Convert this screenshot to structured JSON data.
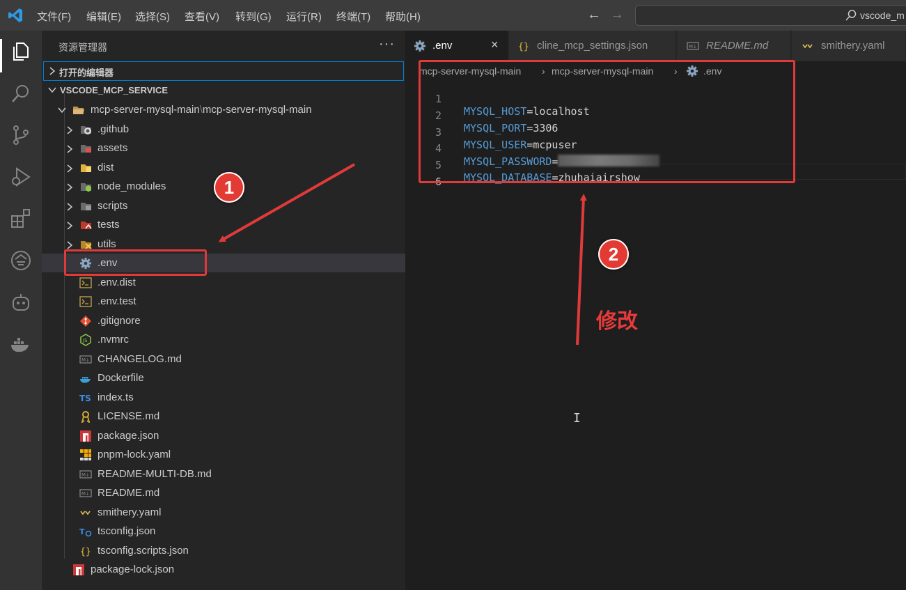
{
  "menu": [
    "文件(F)",
    "编辑(E)",
    "选择(S)",
    "查看(V)",
    "转到(G)",
    "运行(R)",
    "终端(T)",
    "帮助(H)"
  ],
  "search": {
    "text": "vscode_m"
  },
  "sidebar": {
    "title": "资源管理器",
    "open_editors": "打开的编辑器",
    "workspace": "VSCODE_MCP_SERVICE",
    "root_folder": {
      "name": "mcp-server-mysql-main",
      "sep": "\\",
      "subname": "mcp-server-mysql-main"
    },
    "folders": [
      {
        "name": ".github",
        "icon": "github-folder-icon"
      },
      {
        "name": "assets",
        "icon": "assets-folder-icon"
      },
      {
        "name": "dist",
        "icon": "dist-folder-icon"
      },
      {
        "name": "node_modules",
        "icon": "node-folder-icon"
      },
      {
        "name": "scripts",
        "icon": "scripts-folder-icon"
      },
      {
        "name": "tests",
        "icon": "tests-folder-icon"
      },
      {
        "name": "utils",
        "icon": "utils-folder-icon"
      }
    ],
    "files": [
      {
        "name": ".env",
        "icon": "gear-icon",
        "selected": true
      },
      {
        "name": ".env.dist",
        "icon": "terminal-icon"
      },
      {
        "name": ".env.test",
        "icon": "terminal-icon"
      },
      {
        "name": ".gitignore",
        "icon": "git-icon"
      },
      {
        "name": ".nvmrc",
        "icon": "nodejs-icon"
      },
      {
        "name": "CHANGELOG.md",
        "icon": "markdown-icon"
      },
      {
        "name": "Dockerfile",
        "icon": "docker-icon"
      },
      {
        "name": "index.ts",
        "icon": "typescript-icon"
      },
      {
        "name": "LICENSE.md",
        "icon": "license-icon"
      },
      {
        "name": "package.json",
        "icon": "npm-icon"
      },
      {
        "name": "pnpm-lock.yaml",
        "icon": "pnpm-icon"
      },
      {
        "name": "README-MULTI-DB.md",
        "icon": "markdown-icon"
      },
      {
        "name": "README.md",
        "icon": "markdown-icon"
      },
      {
        "name": "smithery.yaml",
        "icon": "yaml-icon"
      },
      {
        "name": "tsconfig.json",
        "icon": "tsconfig-icon"
      },
      {
        "name": "tsconfig.scripts.json",
        "icon": "json-icon"
      }
    ],
    "outer_file": {
      "name": "package-lock.json",
      "icon": "npm-icon"
    }
  },
  "tabs": [
    {
      "label": ".env",
      "icon": "gear-icon",
      "active": true,
      "close": "×"
    },
    {
      "label": "cline_mcp_settings.json",
      "icon": "json-icon"
    },
    {
      "label": "README.md",
      "icon": "markdown-icon"
    },
    {
      "label": "smithery.yaml",
      "icon": "yaml-icon"
    }
  ],
  "breadcrumb": {
    "part1": "mcp-server-mysql-main",
    "part2": "mcp-server-mysql-main",
    "part3": ".env"
  },
  "code": [
    {
      "ln": "1",
      "key": "MYSQL_HOST",
      "eq": "=",
      "val": "localhost"
    },
    {
      "ln": "2",
      "key": "MYSQL_PORT",
      "eq": "=",
      "val": "3306"
    },
    {
      "ln": "3",
      "key": "MYSQL_USER",
      "eq": "=",
      "val": "mcpuser"
    },
    {
      "ln": "4",
      "key": "MYSQL_PASSWORD",
      "eq": "=",
      "val": ""
    },
    {
      "ln": "5",
      "key": "MYSQL_DATABASE",
      "eq": "=",
      "val": "zhuhaiairshow"
    },
    {
      "ln": "6",
      "key": "",
      "eq": "",
      "val": ""
    }
  ],
  "annotations": {
    "step1": "1",
    "step2": "2",
    "label": "修改"
  },
  "colors": {
    "accent_red": "#e03a3a",
    "keyword_blue": "#569cd6",
    "focus_blue": "#007fd4"
  }
}
